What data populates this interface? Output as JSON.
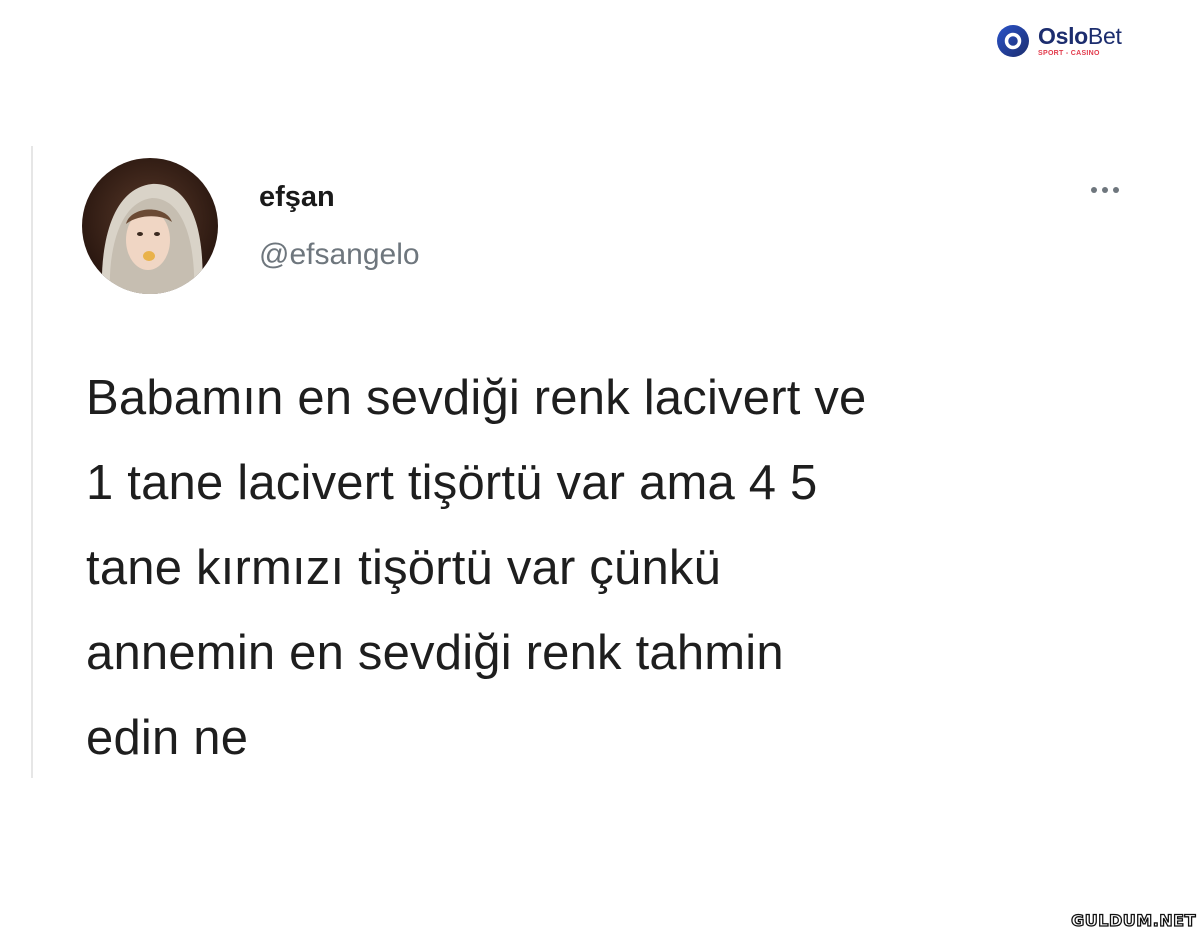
{
  "brand": {
    "name_bold": "Oslo",
    "name_thin": "Bet",
    "tagline": "SPORT - CASINO",
    "icon": "oslobet-logo-icon",
    "colors": {
      "primary": "#1c2d6e",
      "accent": "#e23a4b"
    }
  },
  "tweet": {
    "avatar_icon": "user-avatar-photo",
    "display_name": "efşan",
    "handle": "@efsangelo",
    "more_icon": "more-options-icon",
    "text_lines": [
      "Babamın en sevdiği renk lacivert ve",
      "1 tane lacivert tişörtü var ama 4 5",
      "tane kırmızı tişörtü var çünkü",
      "annemin en sevdiği renk tahmin",
      "edin ne"
    ]
  },
  "footer": {
    "site": "GULDUM.NET"
  }
}
